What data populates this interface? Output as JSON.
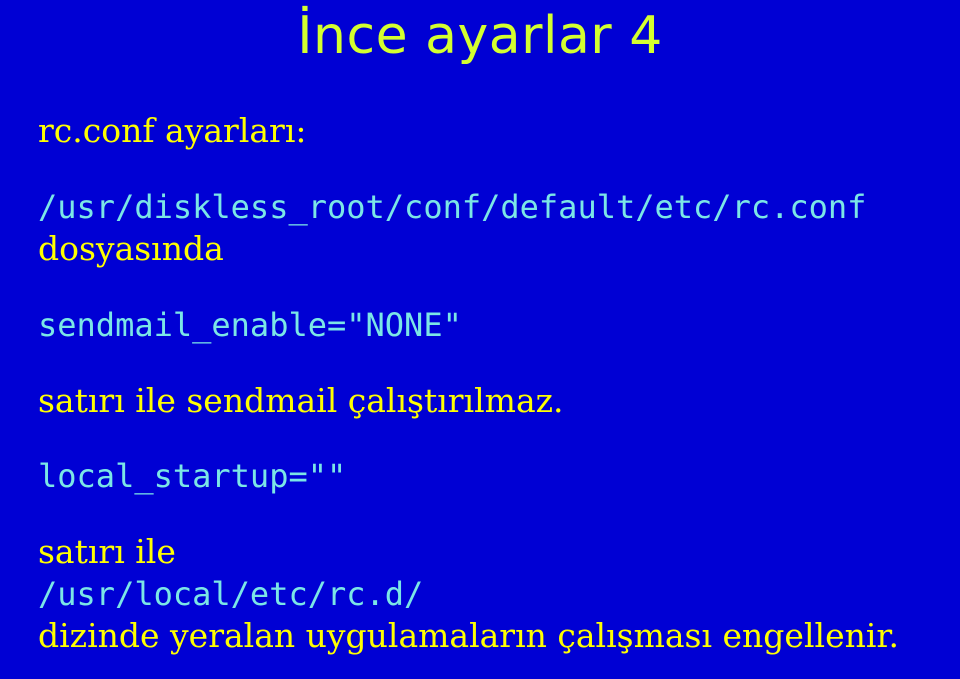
{
  "title": "İnce ayarlar 4",
  "lines": {
    "l1": "rc.conf ayarları:",
    "l2a": "/usr/diskless_root/conf/default/etc/rc.conf",
    "l2b": "dosyasında",
    "l3": "sendmail_enable=\"NONE\"",
    "l4": "satırı ile sendmail çalıştırılmaz.",
    "l5": "local_startup=\"\"",
    "l6a": "satırı ile",
    "l6b": "/usr/local/etc/rc.d/",
    "l6c": "dizinde yeralan uygulamaların çalışması engellenir."
  }
}
